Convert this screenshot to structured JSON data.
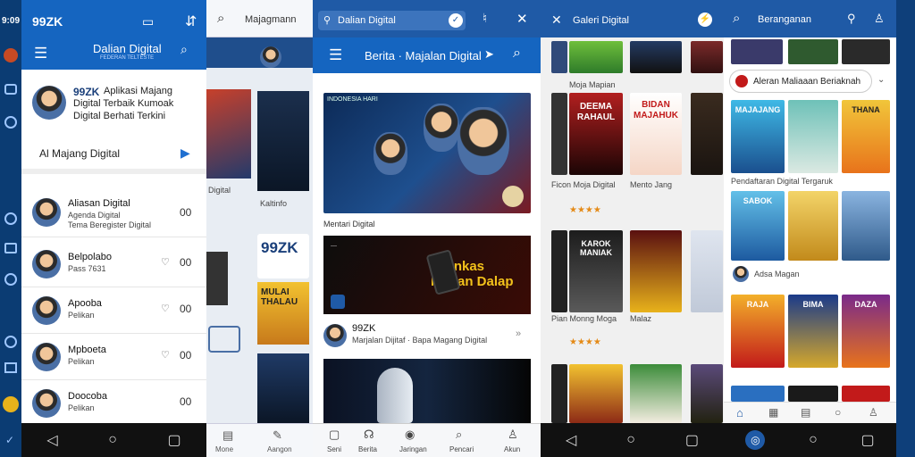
{
  "left_rail": {
    "time": "9:09"
  },
  "panel1": {
    "logo": "99ZK",
    "title": "Dalian Digital",
    "subtitle": "FEDERAN TELTESTE",
    "profile": {
      "name": "99ZK",
      "line1": "Aplikasi Majang",
      "line2": "Digital Terbaik Kumoak",
      "line3": "Digital Berhati Terkini"
    },
    "cta": "Al Majang Digital",
    "contacts": [
      {
        "name": "Aliasan Digital",
        "sub": "Agenda Digital",
        "meta": "Tema Beregister Digital",
        "val": "00"
      },
      {
        "name": "Belpolabo",
        "sub": "Pass 7631",
        "val": "00"
      },
      {
        "name": "Apooba",
        "sub": "Pelikan",
        "val": "00"
      },
      {
        "name": "Mpboeta",
        "sub": "Pelikan",
        "val": "00"
      },
      {
        "name": "Doocoba",
        "sub": "Pelikan",
        "val": "00"
      }
    ]
  },
  "panel2": {
    "search": "Majagmann",
    "cards": [
      "99ZK",
      "MULAI THALAU"
    ],
    "label1": "Digital",
    "label2": "Kaltinfo",
    "nav": [
      "Mone",
      "Aangon"
    ]
  },
  "panel3": {
    "url": "Dalian Digital",
    "title": "Berita · Majalan Digital",
    "hero_caption": "Mentari Digital",
    "banner": "Mojnkas Maban Dalap",
    "source": "99ZK",
    "source_sub": "Marjalan Dijitaf · Bapa Magang Digital",
    "nav": [
      "Seni",
      "Berita",
      "Jaringan",
      "Pencari",
      "Akun"
    ],
    "hero_badge": "INDONESIA HARI"
  },
  "panel4": {
    "title": "Galeri Digital",
    "section": "Moja Mapian",
    "posters": [
      "DEEMA RAHAUL",
      "BIDAN MAJAHUK",
      "KAROK MANIAK"
    ],
    "rows": [
      {
        "a": "Ficon Moja Digital",
        "b": "Mento Jang"
      },
      {
        "a": "Pian Monng Moga",
        "b": "Malaz"
      }
    ],
    "rating": "★★★★"
  },
  "panel5": {
    "search": "Beranganan",
    "filter": "Aleran Maliaaan Beriaknah",
    "captions": [
      "Pendaftaran Digital Tergaruk",
      "Adsa Magan"
    ],
    "posters": [
      "MAJAJANG",
      "THANA",
      "SABOK",
      "RAJA",
      "BIMA",
      "DAZA"
    ],
    "nav_icons": [
      "home-icon",
      "grid-icon",
      "doc-icon",
      "circle-icon",
      "profile-icon"
    ]
  }
}
